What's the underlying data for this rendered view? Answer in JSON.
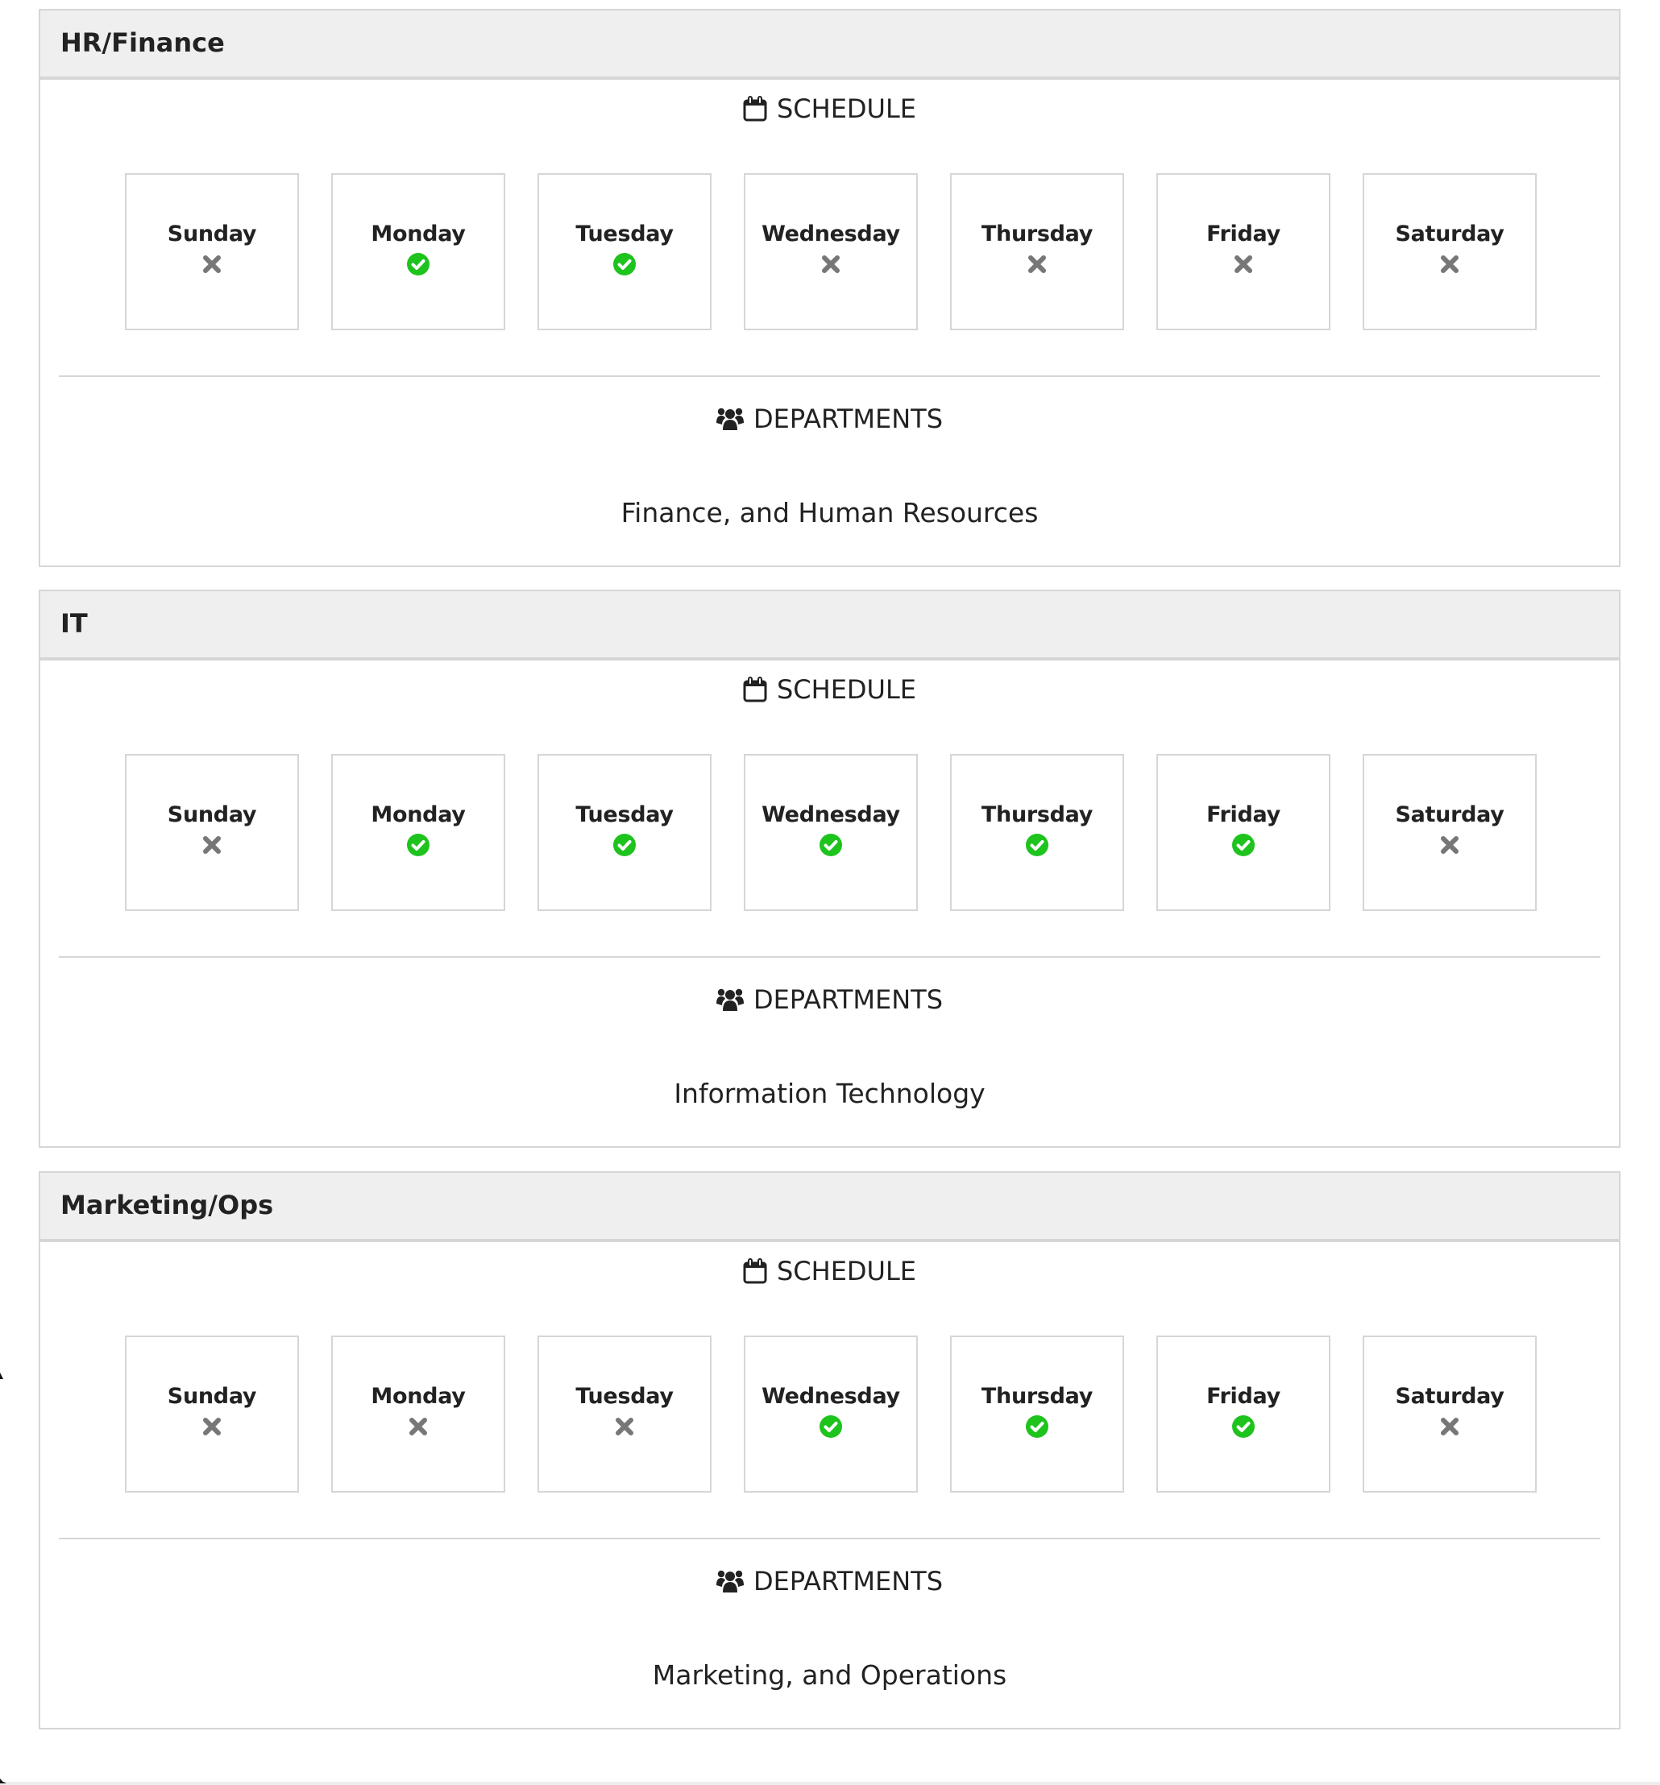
{
  "icons": {
    "schedule": "calendar-icon",
    "departments": "users-icon",
    "working": "check-circle-icon",
    "off": "x-icon"
  },
  "colors": {
    "working": "#1ec31e",
    "off": "#777777",
    "header_bg": "#efefef",
    "border": "#d6d6d6"
  },
  "labels": {
    "schedule": "SCHEDULE",
    "departments": "DEPARTMENTS"
  },
  "panels": [
    {
      "title": "HR/Finance",
      "schedule": [
        {
          "day": "Sunday",
          "working": false
        },
        {
          "day": "Monday",
          "working": true
        },
        {
          "day": "Tuesday",
          "working": true
        },
        {
          "day": "Wednesday",
          "working": false
        },
        {
          "day": "Thursday",
          "working": false
        },
        {
          "day": "Friday",
          "working": false
        },
        {
          "day": "Saturday",
          "working": false
        }
      ],
      "departments": "Finance, and Human Resources"
    },
    {
      "title": "IT",
      "schedule": [
        {
          "day": "Sunday",
          "working": false
        },
        {
          "day": "Monday",
          "working": true
        },
        {
          "day": "Tuesday",
          "working": true
        },
        {
          "day": "Wednesday",
          "working": true
        },
        {
          "day": "Thursday",
          "working": true
        },
        {
          "day": "Friday",
          "working": true
        },
        {
          "day": "Saturday",
          "working": false
        }
      ],
      "departments": "Information Technology"
    },
    {
      "title": "Marketing/Ops",
      "schedule": [
        {
          "day": "Sunday",
          "working": false
        },
        {
          "day": "Monday",
          "working": false
        },
        {
          "day": "Tuesday",
          "working": false
        },
        {
          "day": "Wednesday",
          "working": true
        },
        {
          "day": "Thursday",
          "working": true
        },
        {
          "day": "Friday",
          "working": true
        },
        {
          "day": "Saturday",
          "working": false
        }
      ],
      "departments": "Marketing, and Operations"
    }
  ]
}
